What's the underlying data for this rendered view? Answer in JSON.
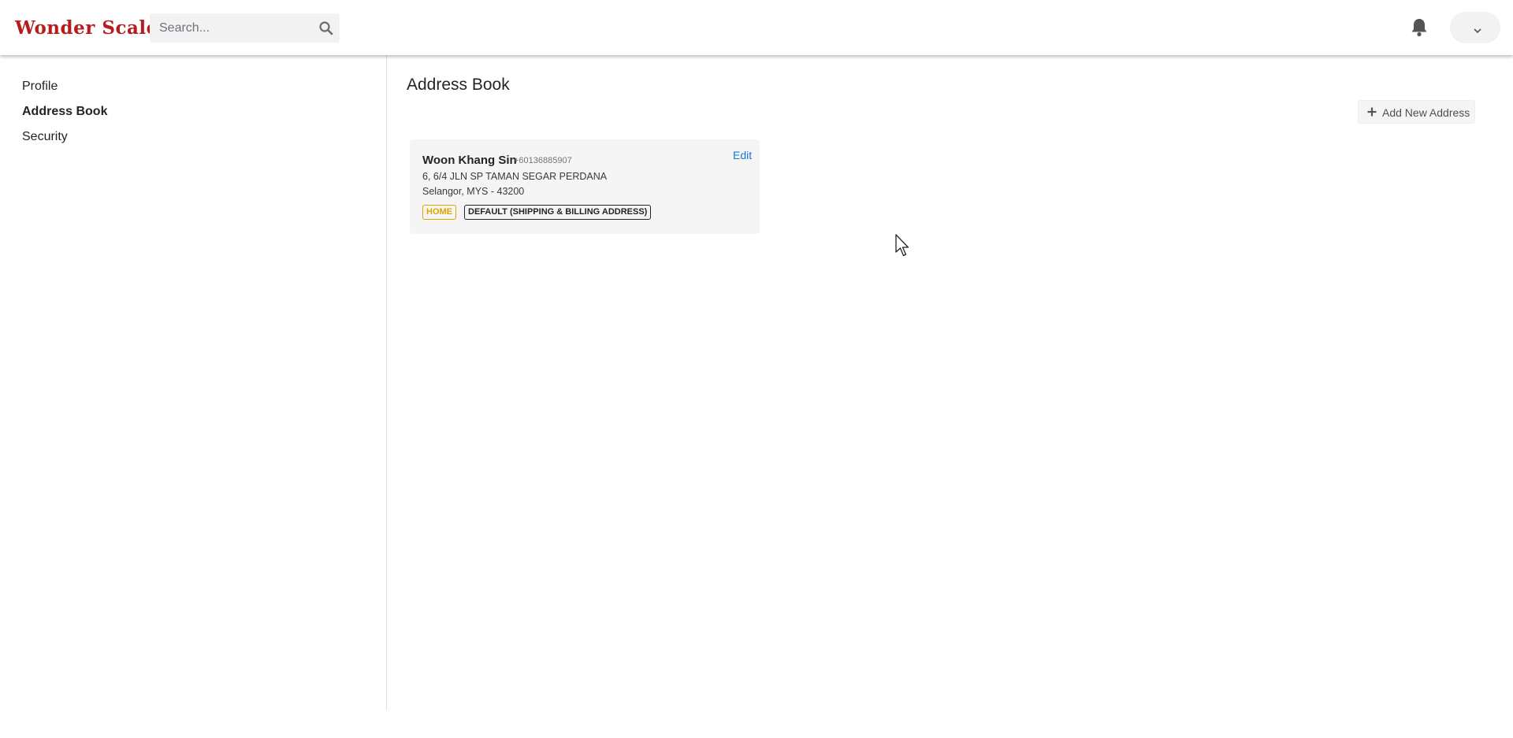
{
  "header": {
    "logo_text": "Wonder Scale",
    "search_placeholder": "Search...",
    "brand_color": "#b71c1c",
    "icons": [
      "search-icon",
      "bell-icon",
      "chevron-down-icon"
    ]
  },
  "sidebar": {
    "items": [
      {
        "label": "Profile",
        "active": false
      },
      {
        "label": "Address Book",
        "active": true
      },
      {
        "label": "Security",
        "active": false
      }
    ]
  },
  "main": {
    "title": "Address Book",
    "add_button_label": "Add New Address",
    "addresses": [
      {
        "name": "Woon Khang Sin",
        "phone": "+60136885907",
        "line1": "6, 6/4 JLN SP TAMAN SEGAR PERDANA",
        "line2": "Selangor, MYS - 43200",
        "edit_label": "Edit",
        "tags": [
          "HOME",
          "DEFAULT (SHIPPING & BILLING ADDRESS)"
        ]
      }
    ]
  }
}
